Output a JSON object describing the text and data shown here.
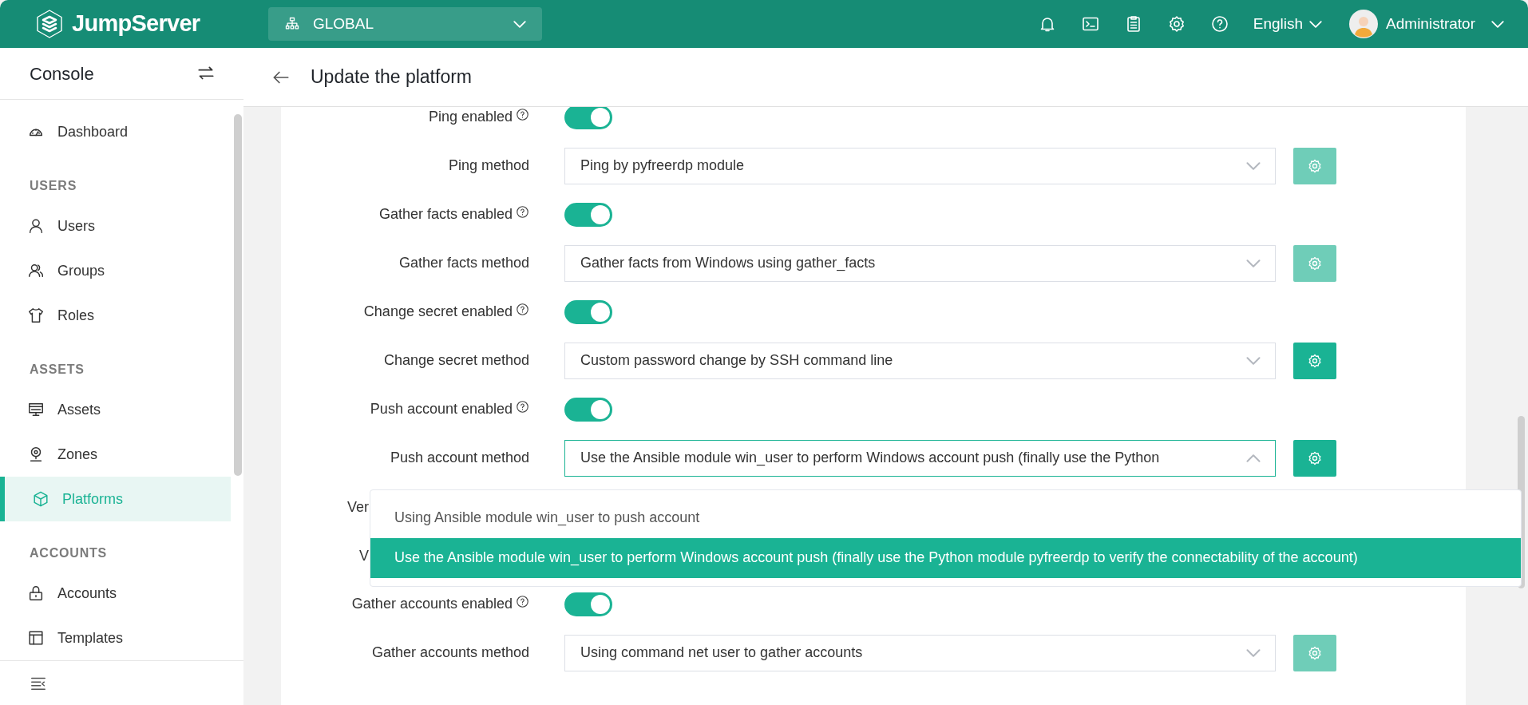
{
  "header": {
    "logo": "JumpServer",
    "organization": "GLOBAL",
    "language": "English",
    "user": "Administrator"
  },
  "sidebar": {
    "title": "Console",
    "items": [
      {
        "kind": "item",
        "label": "Dashboard",
        "selected": false
      },
      {
        "kind": "heading",
        "label": "USERS"
      },
      {
        "kind": "item",
        "label": "Users",
        "selected": false
      },
      {
        "kind": "item",
        "label": "Groups",
        "selected": false
      },
      {
        "kind": "item",
        "label": "Roles",
        "selected": false
      },
      {
        "kind": "heading",
        "label": "ASSETS"
      },
      {
        "kind": "item",
        "label": "Assets",
        "selected": false
      },
      {
        "kind": "item",
        "label": "Zones",
        "selected": false
      },
      {
        "kind": "item",
        "label": "Platforms",
        "selected": true
      },
      {
        "kind": "heading",
        "label": "ACCOUNTS"
      },
      {
        "kind": "item",
        "label": "Accounts",
        "selected": false
      },
      {
        "kind": "item",
        "label": "Templates",
        "selected": false
      }
    ]
  },
  "page": {
    "title": "Update the platform"
  },
  "form": {
    "rows": [
      {
        "kind": "toggle",
        "label": "Ping enabled",
        "help": true,
        "on": true
      },
      {
        "kind": "select",
        "label": "Ping method",
        "value": "Ping by pyfreerdp module",
        "open": false,
        "action_enabled": false
      },
      {
        "kind": "toggle",
        "label": "Gather facts enabled",
        "help": true,
        "on": true
      },
      {
        "kind": "select",
        "label": "Gather facts method",
        "value": "Gather facts from Windows using gather_facts",
        "open": false,
        "action_enabled": false
      },
      {
        "kind": "toggle",
        "label": "Change secret enabled",
        "help": true,
        "on": true
      },
      {
        "kind": "select",
        "label": "Change secret method",
        "value": "Custom password change by SSH command line",
        "open": false,
        "action_enabled": true
      },
      {
        "kind": "toggle",
        "label": "Push account enabled",
        "help": true,
        "on": true
      },
      {
        "kind": "select",
        "label": "Push account method",
        "value": "Use the Ansible module win_user to perform Windows account push (finally use the Python",
        "open": true,
        "action_enabled": true
      },
      {
        "kind": "cut",
        "label": "Ver"
      },
      {
        "kind": "cut",
        "label": "V"
      },
      {
        "kind": "toggle",
        "label": "Gather accounts enabled",
        "help": true,
        "on": true
      },
      {
        "kind": "select",
        "label": "Gather accounts method",
        "value": "Using command net user to gather accounts",
        "open": false,
        "action_enabled": false
      }
    ]
  },
  "dropdown": {
    "options": [
      {
        "label": "Using Ansible module win_user to push account",
        "selected": false
      },
      {
        "label": "Use the Ansible module win_user to perform Windows account push (finally use the Python module pyfreerdp to verify the connectability of the account)",
        "selected": true
      }
    ]
  }
}
